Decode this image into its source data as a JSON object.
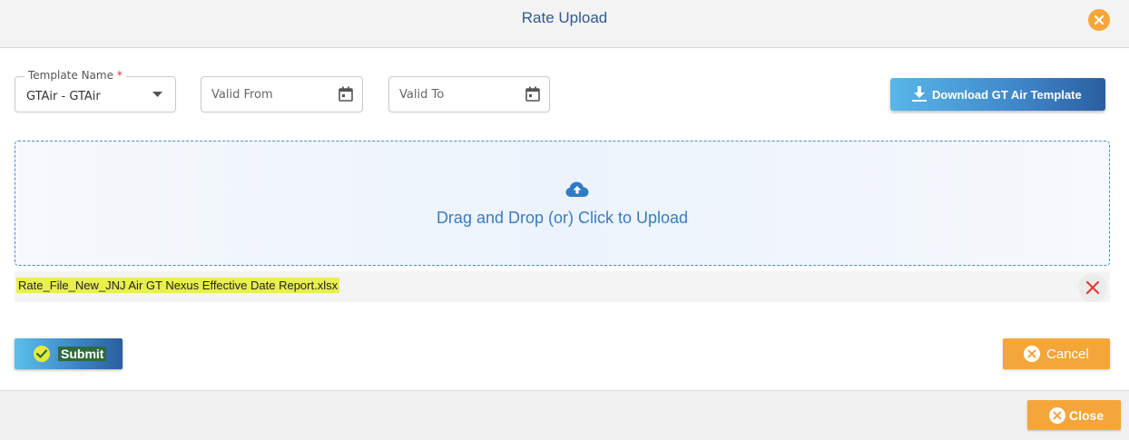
{
  "dialog": {
    "title": "Rate Upload"
  },
  "form": {
    "template": {
      "label": "Template Name",
      "required_mark": "*",
      "value": "GTAir - GTAir"
    },
    "valid_from": {
      "placeholder": "Valid From"
    },
    "valid_to": {
      "placeholder": "Valid To"
    },
    "download_button": "Download GT Air Template"
  },
  "dropzone": {
    "text": "Drag and Drop (or) Click to Upload"
  },
  "file": {
    "name": "Rate_File_New_JNJ Air GT Nexus Effective Date Report.xlsx"
  },
  "actions": {
    "submit": "Submit",
    "cancel": "Cancel",
    "close": "Close"
  },
  "colors": {
    "accent_blue": "#3f86c9",
    "orange": "#f4a63a",
    "title": "#2f5a8f",
    "remove_red": "#e53935"
  },
  "icons": {
    "header_close": "close-circle-icon",
    "dropdown": "caret-down-icon",
    "date": "calendar-icon",
    "download": "download-icon",
    "upload": "cloud-upload-icon",
    "remove": "x-icon",
    "submit": "check-circle-icon",
    "cancel": "close-circle-icon"
  }
}
